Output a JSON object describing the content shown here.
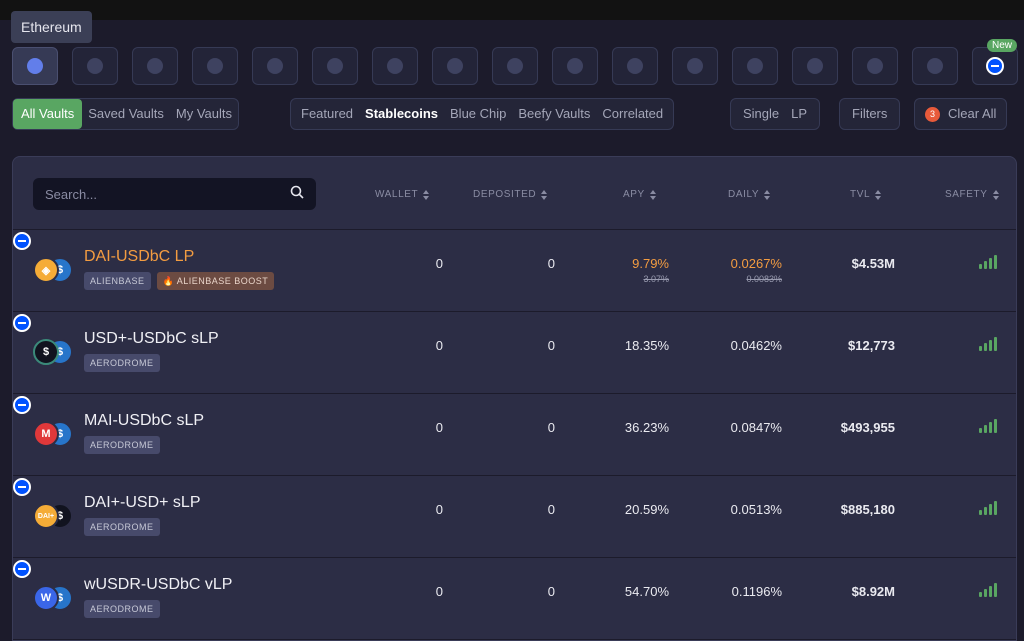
{
  "tooltip": "Ethereum",
  "chains": [
    {
      "icon": "ethereum-icon",
      "active": true
    },
    {
      "icon": "chain-icon-2"
    },
    {
      "icon": "chain-icon-3"
    },
    {
      "icon": "chain-icon-4"
    },
    {
      "icon": "chain-icon-5"
    },
    {
      "icon": "chain-icon-6"
    },
    {
      "icon": "chain-icon-7"
    },
    {
      "icon": "chain-icon-8"
    },
    {
      "icon": "chain-icon-9"
    },
    {
      "icon": "chain-icon-10"
    },
    {
      "icon": "chain-icon-11"
    },
    {
      "icon": "chain-icon-12"
    },
    {
      "icon": "chain-icon-13"
    },
    {
      "icon": "chain-icon-14"
    },
    {
      "icon": "chain-icon-15"
    },
    {
      "icon": "chain-icon-16"
    },
    {
      "icon": "base-icon",
      "badge": "New"
    }
  ],
  "vault_tabs": [
    "All Vaults",
    "Saved Vaults",
    "My Vaults"
  ],
  "categories": [
    "Featured",
    "Stablecoins",
    "Blue Chip",
    "Beefy Vaults",
    "Correlated"
  ],
  "types": [
    "Single",
    "LP"
  ],
  "filters_label": "Filters",
  "clear": {
    "count": "3",
    "label": "Clear All"
  },
  "search": {
    "placeholder": "Search..."
  },
  "columns": {
    "wallet": "WALLET",
    "deposited": "DEPOSITED",
    "apy": "APY",
    "daily": "DAILY",
    "tvl": "TVL",
    "safety": "SAFETY"
  },
  "colors": {
    "accent_green": "#59a662",
    "accent_orange": "#f39c41",
    "base_blue": "#0052ff"
  },
  "vaults": [
    {
      "name": "DAI-USDbC LP",
      "tags": [
        "ALIENBASE",
        "🔥 ALIENBASE BOOST"
      ],
      "wallet": "0",
      "deposited": "0",
      "apy": "9.79%",
      "apy_old": "3.07%",
      "daily": "0.0267%",
      "daily_old": "0.0083%",
      "tvl": "$4.53M",
      "highlight": true,
      "token_a": "DAI"
    },
    {
      "name": "USD+-USDbC sLP",
      "tags": [
        "AERODROME"
      ],
      "wallet": "0",
      "deposited": "0",
      "apy": "18.35%",
      "daily": "0.0462%",
      "tvl": "$12,773",
      "token_a": "USD+"
    },
    {
      "name": "MAI-USDbC sLP",
      "tags": [
        "AERODROME"
      ],
      "wallet": "0",
      "deposited": "0",
      "apy": "36.23%",
      "daily": "0.0847%",
      "tvl": "$493,955",
      "token_a": "MAI"
    },
    {
      "name": "DAI+-USD+ sLP",
      "tags": [
        "AERODROME"
      ],
      "wallet": "0",
      "deposited": "0",
      "apy": "20.59%",
      "daily": "0.0513%",
      "tvl": "$885,180",
      "token_a": "DAI+"
    },
    {
      "name": "wUSDR-USDbC vLP",
      "tags": [
        "AERODROME"
      ],
      "wallet": "0",
      "deposited": "0",
      "apy": "54.70%",
      "daily": "0.1196%",
      "tvl": "$8.92M",
      "token_a": "wUSDR"
    }
  ]
}
